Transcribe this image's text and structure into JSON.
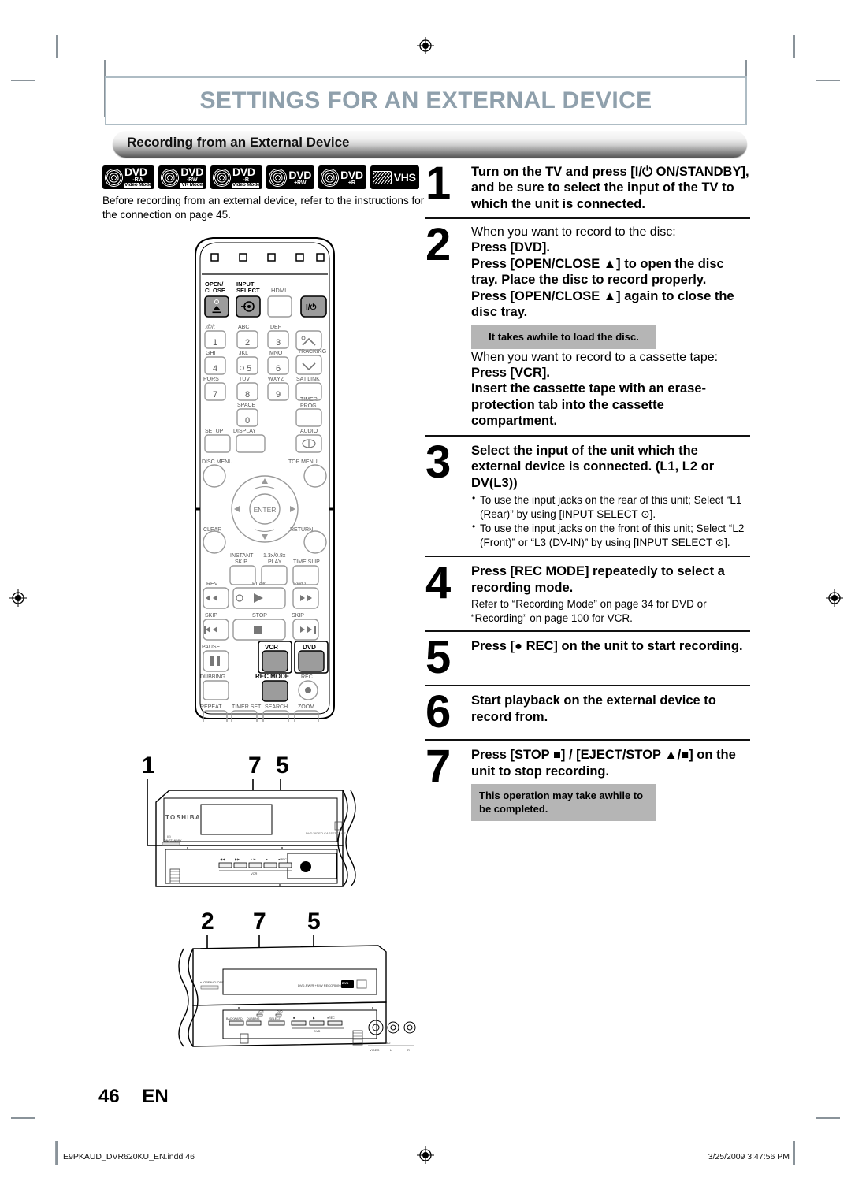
{
  "document": {
    "title": "SETTINGS FOR AN EXTERNAL DEVICE",
    "section": "Recording from an External Device",
    "page_number": "46",
    "language_code": "EN",
    "title_color": "#8fa0ac"
  },
  "media_logos": [
    {
      "kind": "disc",
      "name": "DVD",
      "sub": "-RW",
      "mode": "Video Mode"
    },
    {
      "kind": "disc",
      "name": "DVD",
      "sub": "-RW",
      "mode": "VR Mode"
    },
    {
      "kind": "disc",
      "name": "DVD",
      "sub": "-R",
      "mode": "Video Mode"
    },
    {
      "kind": "disc",
      "name": "DVD",
      "sub": "+RW",
      "mode": ""
    },
    {
      "kind": "disc",
      "name": "DVD",
      "sub": "+R",
      "mode": ""
    },
    {
      "kind": "tape",
      "name": "VHS",
      "sub": "",
      "mode": ""
    }
  ],
  "intro": "Before recording from an external device, refer to the instructions for the connection on page 45.",
  "remote": {
    "top_indicator_count": 5,
    "buttons": [
      "OPEN/CLOSE",
      "INPUT SELECT",
      "HDMI",
      "I/⏻",
      ".@/:",
      "1",
      "ABC",
      "2",
      "DEF",
      "3",
      "GHI",
      "4",
      "JKL",
      "5",
      "MNO",
      "6",
      "TRACKING",
      "PQRS",
      "7",
      "TUV",
      "8",
      "WXYZ",
      "9",
      "SAT.LINK",
      "SPACE",
      "0",
      "TIMER PROG.",
      "SETUP",
      "DISPLAY",
      "AUDIO",
      "DISC MENU",
      "TOP MENU",
      "ENTER",
      "CLEAR",
      "RETURN",
      "INSTANT SKIP",
      "1.3x/0.8x PLAY",
      "TIME SLIP",
      "REV",
      "PLAY",
      "FWD",
      "SKIP",
      "STOP",
      "SKIP",
      "PAUSE",
      "VCR",
      "DVD",
      "DUBBING",
      "REC MODE",
      "REC",
      "REPEAT",
      "TIMER SET",
      "SEARCH",
      "ZOOM"
    ],
    "highlighted_buttons": [
      "OPEN/CLOSE",
      "INPUT SELECT",
      "I/⏻",
      "VCR",
      "DVD",
      "REC MODE"
    ]
  },
  "device_front": {
    "brand": "TOSHIBA",
    "model_text": "DVD VIDEO CASSETTE RE",
    "standby_label": "I/⏻ ON/STANDBY",
    "vcr_row_label": "VCR",
    "vcr_buttons": [
      "◀◀",
      "▶▶",
      "▲/■",
      "▶",
      "● REC"
    ],
    "callouts_top": [
      "1",
      "7",
      "5"
    ]
  },
  "device_front_lower": {
    "open_close_label": "▲ OPEN/CLOSE",
    "recording_text": "DVD-RW/R +R/W RECORDING",
    "dvd_row_label": "DVD",
    "dvd_buttons": [
      "■",
      "▶",
      "● REC"
    ],
    "select_label": "SELECT",
    "select_leds": [
      "VCR",
      "DVD"
    ],
    "left_buttons": [
      "BACKWARD",
      "DUBBING"
    ],
    "jack_labels": [
      "VIDEO",
      "L",
      "R",
      "DV IN"
    ],
    "jack_group_left": "L2",
    "jack_group_right": "L3",
    "callouts_top": [
      "2",
      "7",
      "5"
    ]
  },
  "steps": [
    {
      "number": "1",
      "heading": "Turn on the TV and press [I/⏻ ON/STANDBY], and be sure to select the input of the TV to which the unit is connected.",
      "lines": [],
      "bullets": [],
      "note": ""
    },
    {
      "number": "2",
      "heading_underlined": "When you want to record to the disc:",
      "lines": [
        "Press [DVD].",
        "Press [OPEN/CLOSE ▲] to open the disc tray. Place the disc to record properly.",
        "Press [OPEN/CLOSE ▲] again to close the disc tray."
      ],
      "note": "It takes awhile to load the disc.",
      "heading_underlined_2": "When you want to record to a cassette tape:",
      "lines_2": [
        "Press [VCR].",
        "Insert the cassette tape with an erase-protection tab into the cassette compartment."
      ]
    },
    {
      "number": "3",
      "heading": "Select the input of the unit which the external device is connected. (L1, L2 or DV(L3))",
      "bullets": [
        "To use the input jacks on the rear of this unit; Select “L1 (Rear)” by using [INPUT SELECT ⊙].",
        "To use the input jacks on the front of this unit; Select “L2 (Front)” or “L3 (DV-IN)” by using [INPUT SELECT ⊙]."
      ]
    },
    {
      "number": "4",
      "heading": "Press [REC MODE] repeatedly to select a recording mode.",
      "sub": "Refer to “Recording Mode” on page 34 for DVD or “Recording” on page 100 for VCR."
    },
    {
      "number": "5",
      "heading": "Press [● REC] on the unit to start recording."
    },
    {
      "number": "6",
      "heading": "Start playback on the external device to record from."
    },
    {
      "number": "7",
      "heading": "Press [STOP ■] / [EJECT/STOP ▲/■] on the unit to stop recording.",
      "note": "This operation may take awhile to be completed."
    }
  ],
  "footer": {
    "file": "E9PKAUD_DVR620KU_EN.indd   46",
    "timestamp": "3/25/2009   3:47:56 PM"
  }
}
